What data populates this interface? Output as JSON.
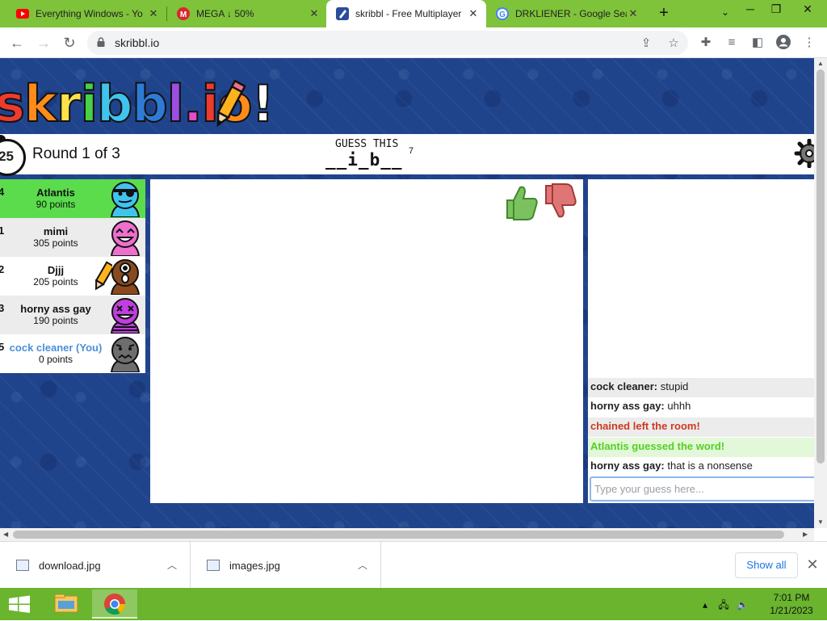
{
  "browser": {
    "tabs": [
      {
        "title": "Everything Windows - Yo",
        "favicon": "youtube-icon",
        "active": false
      },
      {
        "title": "MEGA ↓ 50%",
        "favicon": "mega-icon",
        "active": false
      },
      {
        "title": "skribbl - Free Multiplayer",
        "favicon": "skribbl-icon",
        "active": true
      },
      {
        "title": "DRKLIENER - Google Sea",
        "favicon": "google-icon",
        "active": false
      }
    ],
    "url": "skribbl.io"
  },
  "game": {
    "logo": "skribbl.io",
    "timer": "25",
    "round": "Round 1 of 3",
    "guess_label": "GUESS THIS",
    "word_hint": "__i_b__",
    "word_length": "7",
    "players": [
      {
        "rank": "4",
        "name": "Atlantis",
        "points": "90 points",
        "guessed": true,
        "you": false,
        "drawing": false,
        "avatar_color": "#3fc4ee"
      },
      {
        "rank": "1",
        "name": "mimi",
        "points": "305 points",
        "guessed": false,
        "you": false,
        "drawing": false,
        "avatar_color": "#ef6fcf"
      },
      {
        "rank": "2",
        "name": "Djjj",
        "points": "205 points",
        "guessed": false,
        "you": false,
        "drawing": true,
        "avatar_color": "#8a4a1e"
      },
      {
        "rank": "3",
        "name": "horny ass gay",
        "points": "190 points",
        "guessed": false,
        "you": false,
        "drawing": false,
        "avatar_color": "#c13ee0"
      },
      {
        "rank": "5",
        "name": "cock cleaner (You)",
        "points": "0 points",
        "guessed": false,
        "you": true,
        "drawing": false,
        "avatar_color": "#6e6e6e"
      }
    ],
    "chat": [
      {
        "author": "cock cleaner:",
        "text": " stupid",
        "style": "normal"
      },
      {
        "author": "horny ass gay:",
        "text": " uhhh",
        "style": "normal"
      },
      {
        "author": "",
        "text": "chained left the room!",
        "style": "red"
      },
      {
        "author": "",
        "text": "Atlantis guessed the word!",
        "style": "green"
      },
      {
        "author": "horny ass gay:",
        "text": " that is a nonsense",
        "style": "normal"
      }
    ],
    "guess_placeholder": "Type your guess here..."
  },
  "downloads": {
    "items": [
      {
        "name": "download.jpg"
      },
      {
        "name": "images.jpg"
      }
    ],
    "show_all": "Show all"
  },
  "taskbar": {
    "time": "7:01 PM",
    "date": "1/21/2023"
  },
  "colors": {
    "tabstrip": "#7fc33a",
    "page_background": "#20448c",
    "guessed_player": "#5bdc4c",
    "taskbar": "#6ab42e"
  }
}
